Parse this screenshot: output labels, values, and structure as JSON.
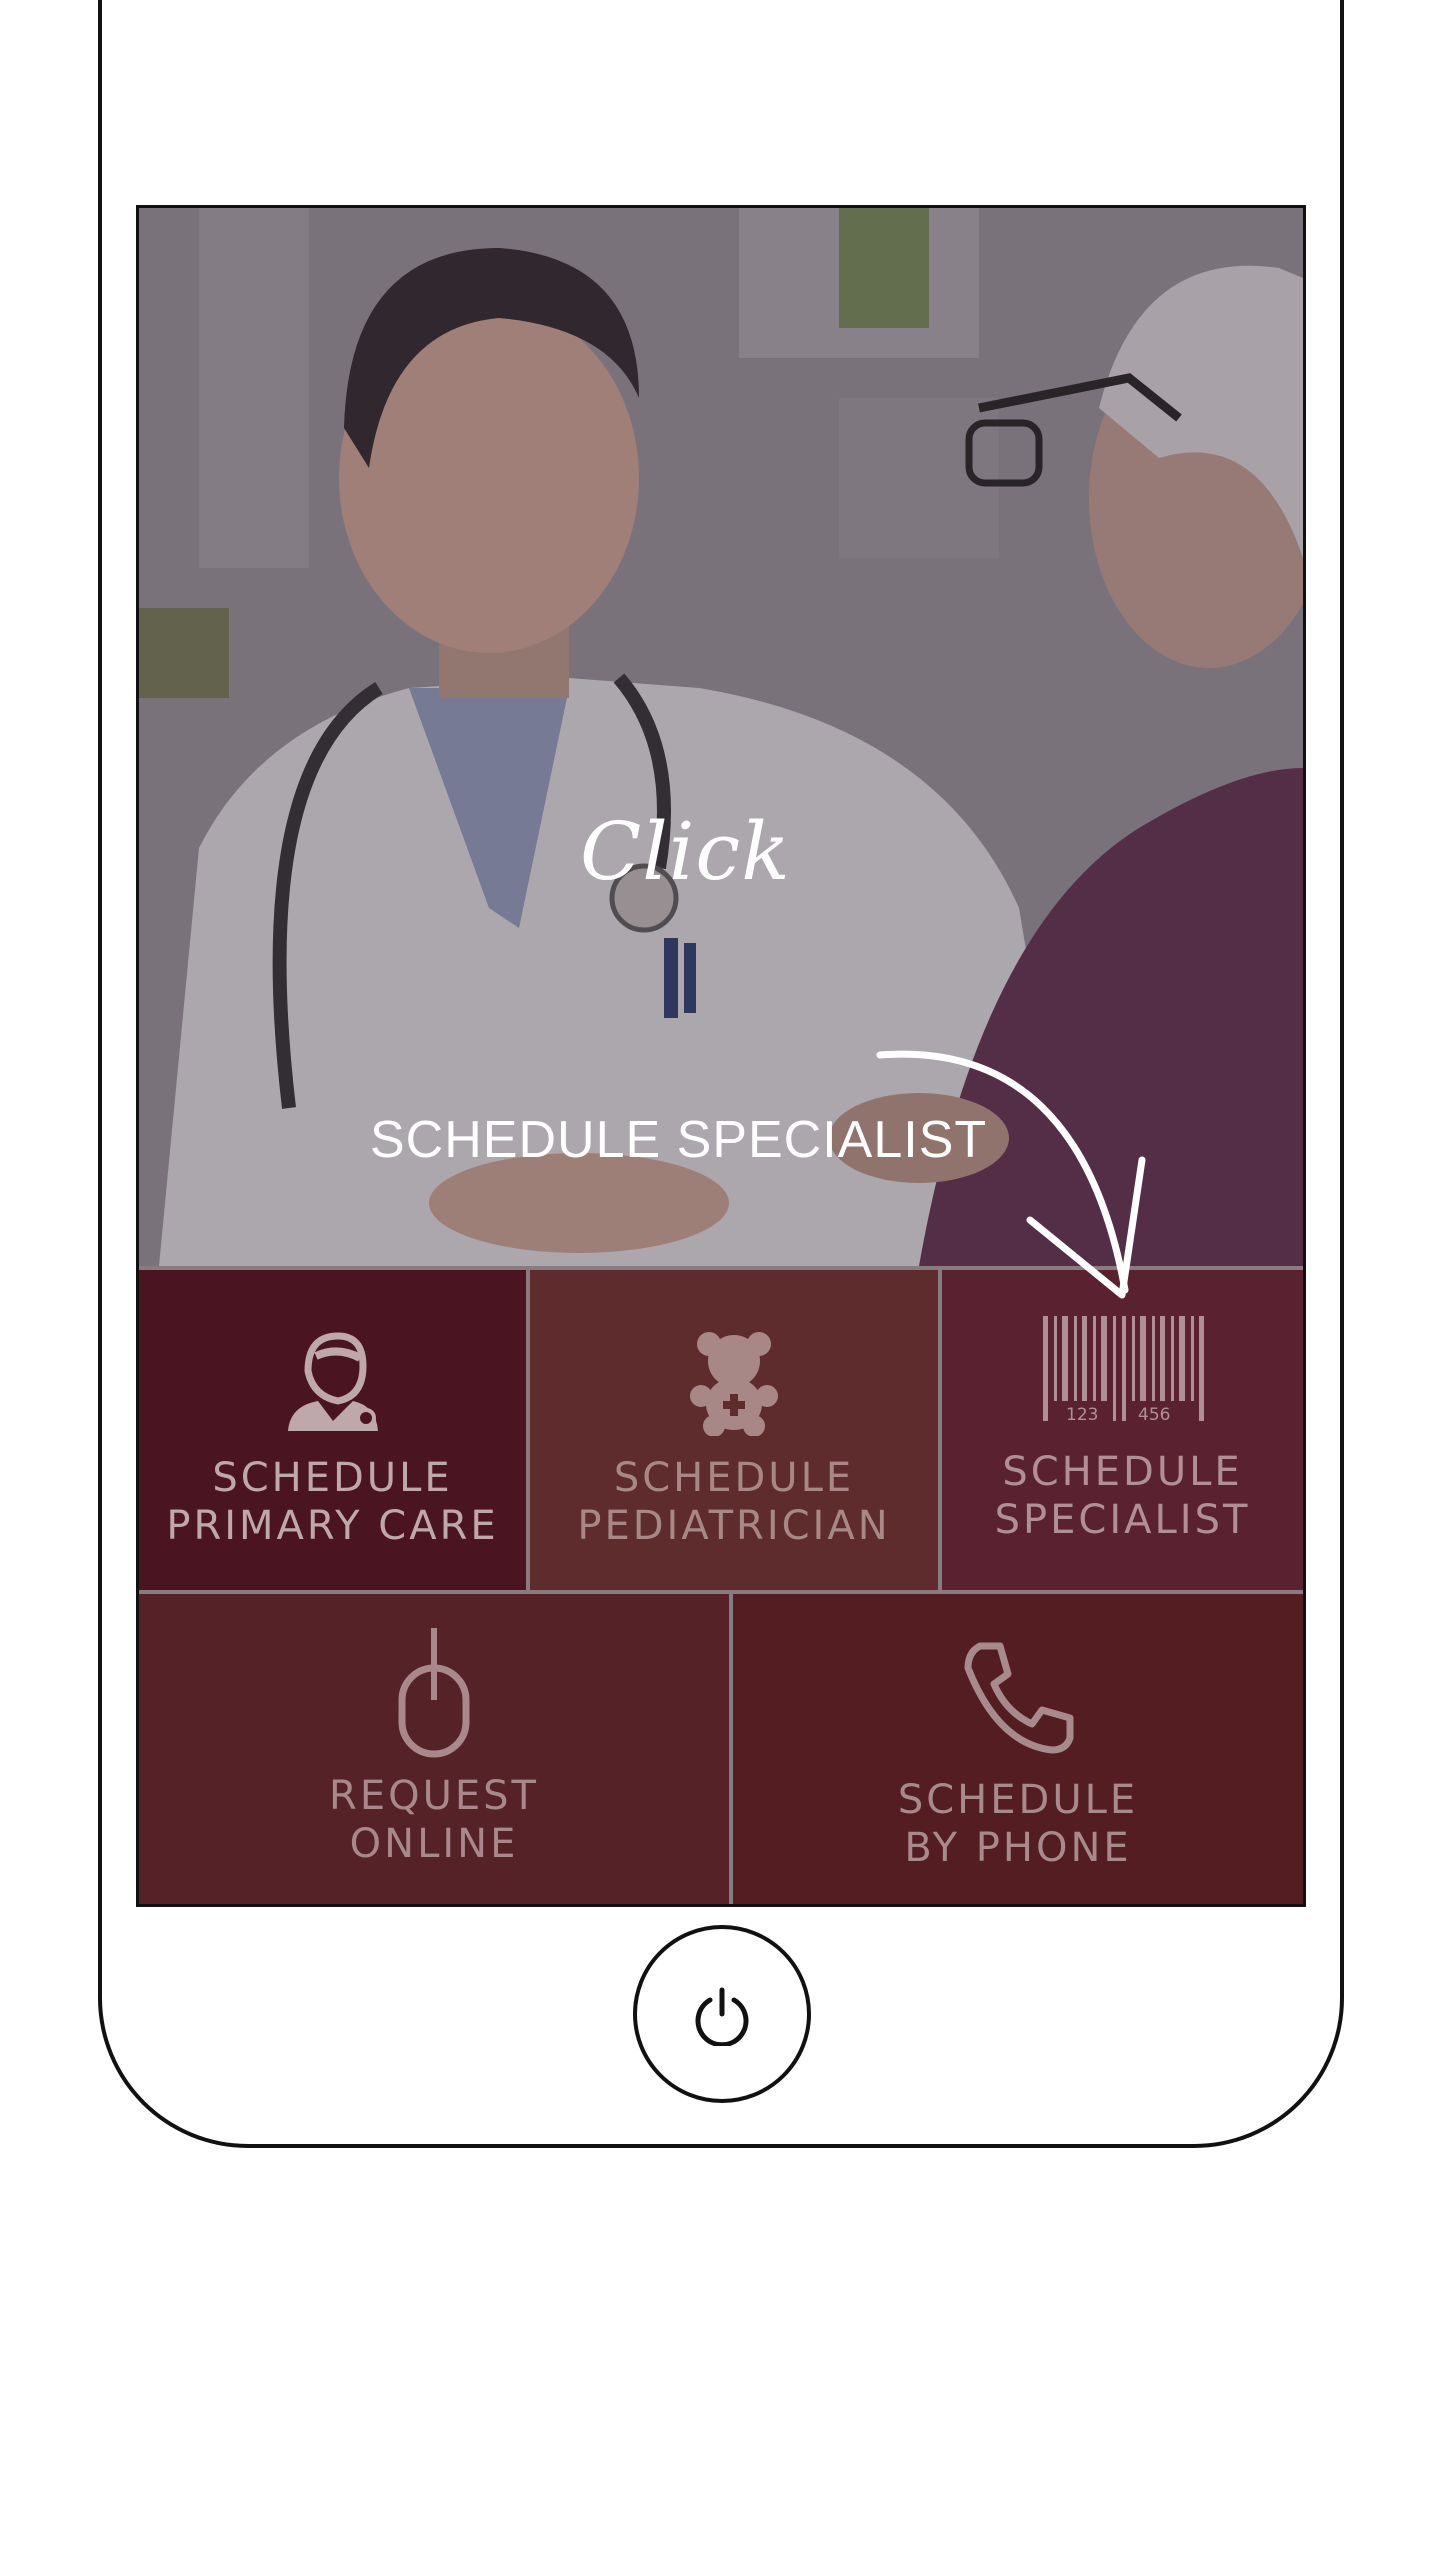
{
  "hint": {
    "click_word": "Click",
    "target_label": "SCHEDULE SPECIALIST"
  },
  "tiles": [
    {
      "icon": "doctor-icon",
      "line1": "SCHEDULE",
      "line2": "PRIMARY CARE"
    },
    {
      "icon": "teddy-bear-icon",
      "line1": "SCHEDULE",
      "line2": "PEDIATRICIAN"
    },
    {
      "icon": "barcode-icon",
      "line1": "SCHEDULE",
      "line2": "SPECIALIST",
      "barcode_digits_left": "123",
      "barcode_digits_right": "456"
    },
    {
      "icon": "mouse-icon",
      "line1": "REQUEST",
      "line2": "ONLINE"
    },
    {
      "icon": "phone-icon",
      "line1": "SCHEDULE",
      "line2": "BY PHONE"
    }
  ],
  "home_button": {
    "icon": "power-icon"
  },
  "colors": {
    "primary_tile": "#4a1520",
    "pediatrician_tile": "#5e2c2c",
    "specialist_tile": "#5a2230",
    "online_tile": "#552227",
    "phone_tile": "#531d22"
  }
}
